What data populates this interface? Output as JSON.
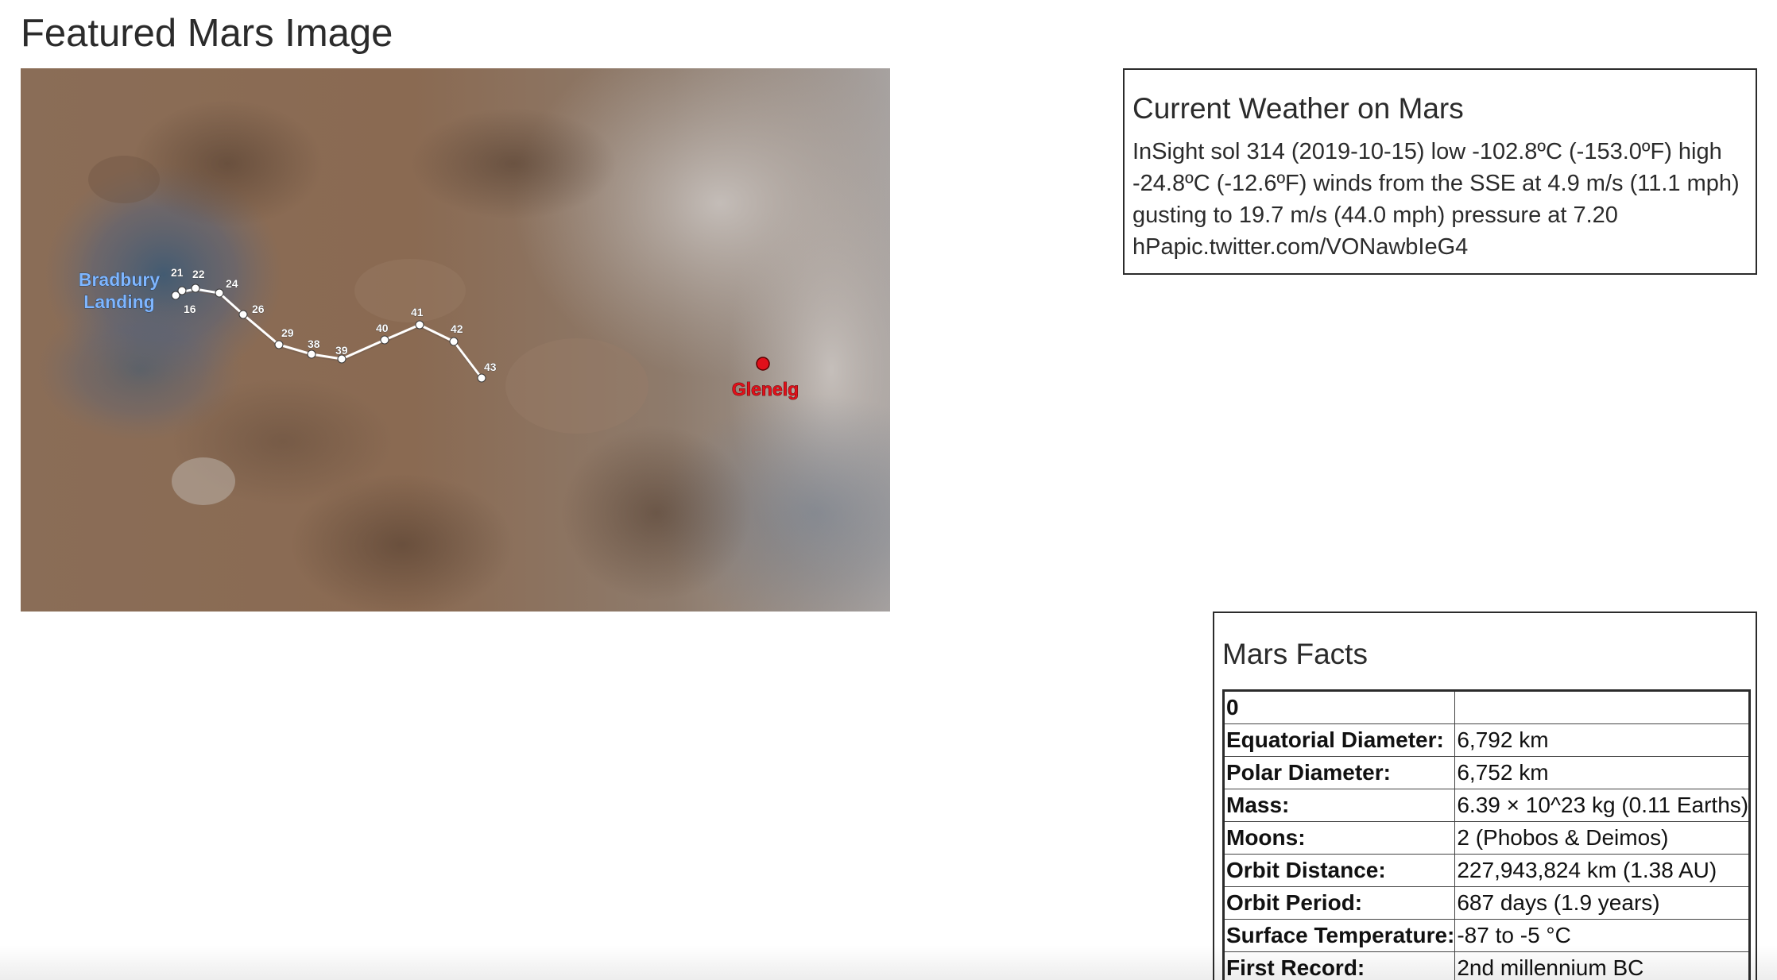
{
  "featured": {
    "title": "Featured Mars Image",
    "image": {
      "landing_label_line1": "Bradbury",
      "landing_label_line2": "Landing",
      "target_label": "Glenelg",
      "route_labels": [
        "21",
        "22",
        "16",
        "24",
        "26",
        "29",
        "38",
        "39",
        "40",
        "41",
        "42",
        "43"
      ],
      "landing_color": "#7fb6ff",
      "target_color": "#e0101a"
    }
  },
  "weather": {
    "title": "Current Weather on Mars",
    "line1": "InSight sol 314 (2019-10-15) low -102.8ºC (-153.0ºF) high",
    "line2": "-24.8ºC (-12.6ºF) winds from the SSE at 4.9 m/s (11.1 mph)",
    "line3": "gusting to 19.7 m/s (44.0 mph) pressure at 7.20",
    "line4": "hPapic.twitter.com/VONawbIeG4"
  },
  "facts": {
    "title": "Mars Facts",
    "header": [
      "0",
      ""
    ],
    "rows": [
      {
        "key": "Equatorial Diameter:",
        "value": "6,792 km"
      },
      {
        "key": "Polar Diameter:",
        "value": "6,752 km"
      },
      {
        "key": "Mass:",
        "value": "6.39 × 10^23 kg (0.11 Earths)"
      },
      {
        "key": "Moons:",
        "value": "2 (Phobos & Deimos)"
      },
      {
        "key": "Orbit Distance:",
        "value": "227,943,824 km (1.38 AU)"
      },
      {
        "key": "Orbit Period:",
        "value": "687 days (1.9 years)"
      },
      {
        "key": "Surface Temperature:",
        "value": "-87 to -5 °C"
      },
      {
        "key": "First Record:",
        "value": "2nd millennium BC"
      }
    ]
  }
}
